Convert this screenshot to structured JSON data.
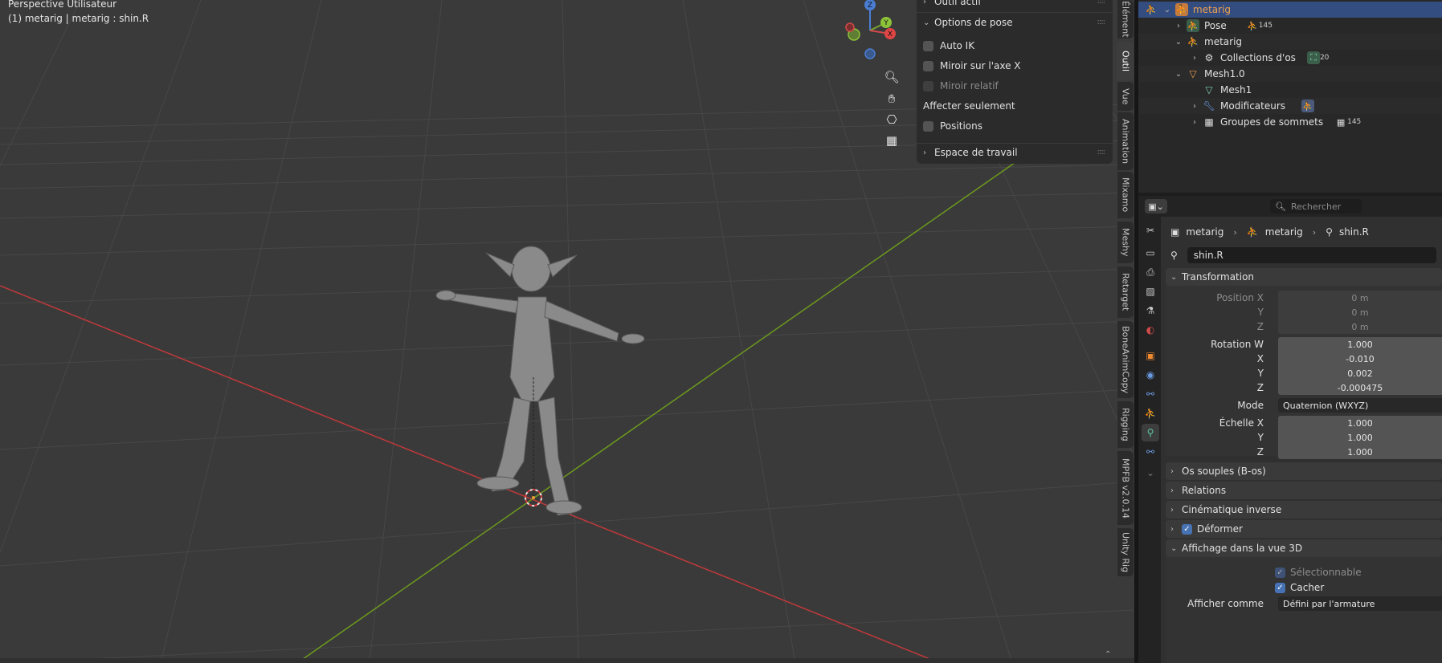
{
  "viewport": {
    "title": "Perspective Utilisateur",
    "subtitle": "(1) metarig | metarig : shin.R",
    "gizmo": {
      "z": "Z",
      "y": "Y",
      "x": "X"
    },
    "nav_icons": [
      "zoom-icon",
      "pan-hand-icon",
      "camera-icon",
      "grid-view-icon"
    ]
  },
  "tool_panel": {
    "section_top": "Outil actif",
    "section_pose": "Options de pose",
    "auto_ik": "Auto IK",
    "mirror_x": "Miroir sur l'axe X",
    "mirror_relative": "Miroir relatif",
    "affect_only": "Affecter seulement",
    "positions": "Positions",
    "section_workspace": "Espace de travail"
  },
  "vertical_tabs": [
    "Élément",
    "Outil",
    "Vue",
    "Animation",
    "Mixamo",
    "Meshy",
    "Retarget",
    "BoneAnimCopy",
    "Rigging",
    "MPFB v2.0.14",
    "Unity Rig"
  ],
  "outliner": {
    "rows": [
      {
        "label": "metarig",
        "badge": ""
      },
      {
        "label": "Pose",
        "badge": "145"
      },
      {
        "label": "metarig",
        "badge": ""
      },
      {
        "label": "Collections d'os",
        "badge": "20"
      },
      {
        "label": "Mesh1.0",
        "badge": ""
      },
      {
        "label": "Mesh1",
        "badge": ""
      },
      {
        "label": "Modificateurs",
        "badge": ""
      },
      {
        "label": "Groupes de sommets",
        "badge": "145"
      }
    ]
  },
  "properties": {
    "search_placeholder": "Rechercher",
    "breadcrumb": [
      "metarig",
      "metarig",
      "shin.R"
    ],
    "bone_name": "shin.R",
    "transformation": {
      "title": "Transformation",
      "position_x_label": "Position X",
      "y_label": "Y",
      "z_label": "Z",
      "x_label": "X",
      "position": [
        "0 m",
        "0 m",
        "0 m"
      ],
      "rotation_w_label": "Rotation W",
      "rotation": [
        "1.000",
        "-0.010",
        "0.002",
        "-0.000475"
      ],
      "mode_label": "Mode",
      "mode_value": "Quaternion (WXYZ)",
      "scale_x_label": "Échelle X",
      "scale": [
        "1.000",
        "1.000",
        "1.000"
      ]
    },
    "panels": {
      "bendy_bones": "Os souples (B-os)",
      "relations": "Relations",
      "inverse_kinematics": "Cinématique inverse",
      "deform": "Déformer",
      "viewport_display": "Affichage dans la vue 3D",
      "selectable": "Sélectionnable",
      "hide": "Cacher",
      "display_as_label": "Afficher comme",
      "display_as_value": "Défini par l'armature"
    }
  },
  "colors": {
    "x_axis": "#c0393b",
    "y_axis": "#6d9a1d",
    "selection": "#334d80",
    "accent": "#4772b3"
  }
}
